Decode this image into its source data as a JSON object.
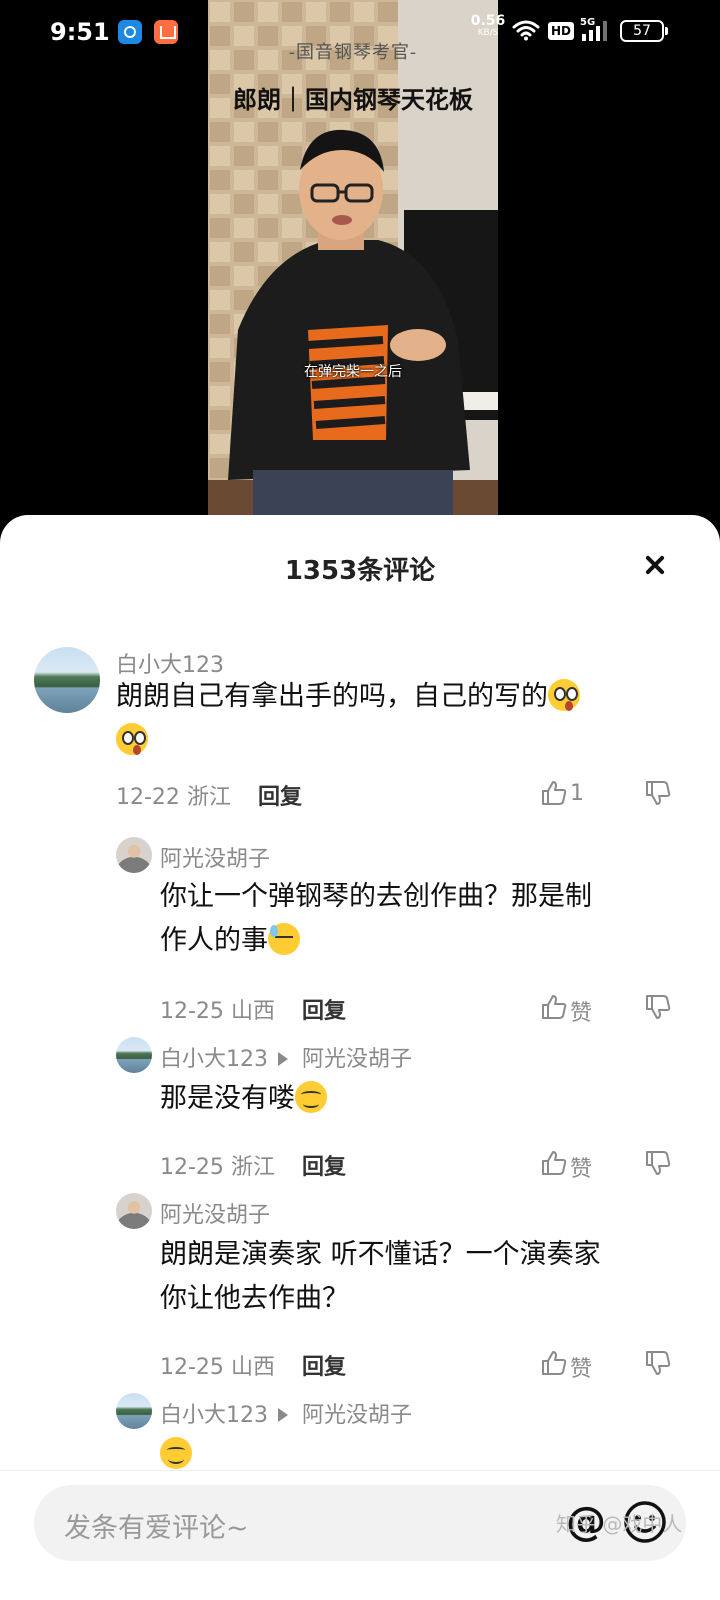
{
  "status": {
    "time": "9:51",
    "net_speed_value": "0.56",
    "net_speed_unit": "KB/S",
    "hd": "HD",
    "network": "5G",
    "battery": "57"
  },
  "video": {
    "channel": "-国音钢琴考官-",
    "title": "郎朗｜国内钢琴天花板",
    "subtitle": "在弹完柴一之后"
  },
  "comments_sheet": {
    "title": "1353条评论",
    "comments": [
      {
        "user": "白小大123",
        "text": "朗朗自己有拿出手的吗，自己的写的",
        "emoji": [
          "astonished-emoji",
          "astonished-emoji"
        ],
        "date": "12-22",
        "location": "浙江",
        "reply_label": "回复",
        "like_count": "1"
      },
      {
        "user": "阿光没胡子",
        "text_line1": "你让一个弹钢琴的去创作曲？那是制",
        "text_line2": "作人的事",
        "emoji": "sweat-emoji",
        "date": "12-25",
        "location": "山西",
        "reply_label": "回复",
        "like_label": "赞"
      },
      {
        "user": "白小大123",
        "reply_to": "阿光没胡子",
        "text": "那是没有喽",
        "emoji": "smug-emoji",
        "date": "12-25",
        "location": "浙江",
        "reply_label": "回复",
        "like_label": "赞"
      },
      {
        "user": "阿光没胡子",
        "text_line1": "朗朗是演奏家 听不懂话？一个演奏家",
        "text_line2": "你让他去作曲？",
        "date": "12-25",
        "location": "山西",
        "reply_label": "回复",
        "like_label": "赞"
      },
      {
        "user": "白小大123",
        "reply_to": "阿光没胡子",
        "emoji": "smile-emoji"
      }
    ]
  },
  "input": {
    "placeholder": "发条有爱评论~"
  },
  "watermark": "知乎 @戏中人",
  "colors": {
    "sheet_bg": "#ffffff",
    "muted_text": "#8a8a8a",
    "input_bg": "#f2f2f2"
  }
}
